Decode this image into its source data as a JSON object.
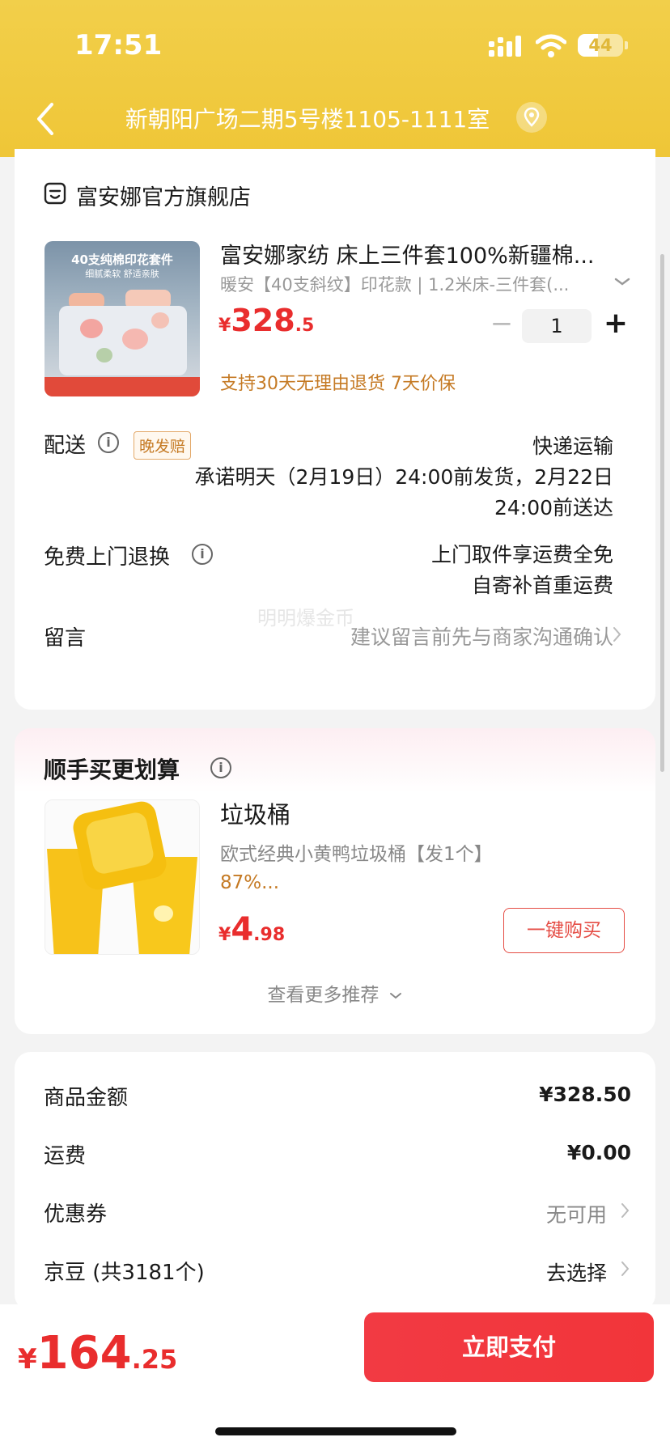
{
  "status_bar": {
    "time": "17:51",
    "battery": "44",
    "battery_level": 0.44
  },
  "header": {
    "address": "新朝阳广场二期5号楼1105-1111室"
  },
  "shop": {
    "name": "富安娜官方旗舰店"
  },
  "product": {
    "image_text_1": "40支纯棉印花套件",
    "image_text_2": "细腻柔软 舒适亲肤",
    "title": "富安娜家纺 床上三件套100%新疆棉...",
    "spec": "暖安【40支斜纹】印花款 | 1.2米床-三件套(...",
    "price_currency": "¥",
    "price_int": "328",
    "price_dec": ".5",
    "quantity": "1",
    "quantity_minus": "−",
    "quantity_plus": "+",
    "policy": "支持30天无理由退货  7天价保"
  },
  "delivery": {
    "label": "配送",
    "badge": "晚发赔",
    "method": "快递运输",
    "line1": "承诺明天（2月19日）24:00前发货，2月22日",
    "line2": "24:00前送达"
  },
  "return_service": {
    "label": "免费上门退换",
    "line1": "上门取件享运费全免",
    "line2": "自寄补首重运费"
  },
  "message": {
    "label": "留言",
    "placeholder": "建议留言前先与商家沟通确认"
  },
  "watermark": "明明爆金币",
  "recommend": {
    "section_title": "顺手买更划算",
    "name": "垃圾桶",
    "desc": "欧式经典小黄鸭垃圾桶【发1个】",
    "percent": "87%...",
    "price_currency": "¥",
    "price_int": "4",
    "price_dec": ".98",
    "buy_label": "一键购买",
    "more_label": "查看更多推荐"
  },
  "summary": {
    "goods_label": "商品金额",
    "goods_value": "¥328.50",
    "shipping_label": "运费",
    "shipping_value": "¥0.00",
    "coupon_label": "优惠券",
    "coupon_value": "无可用",
    "beans_label": "京豆 (共3181个)",
    "beans_value": "去选择"
  },
  "footer": {
    "total_currency": "¥",
    "total_int": "164",
    "total_dec": ".25",
    "pay_label": "立即支付"
  },
  "colors": {
    "header": "#f0c93c",
    "price_red": "#e92d2d",
    "policy_orange": "#c57a24",
    "pay_button": "#f23a43"
  }
}
